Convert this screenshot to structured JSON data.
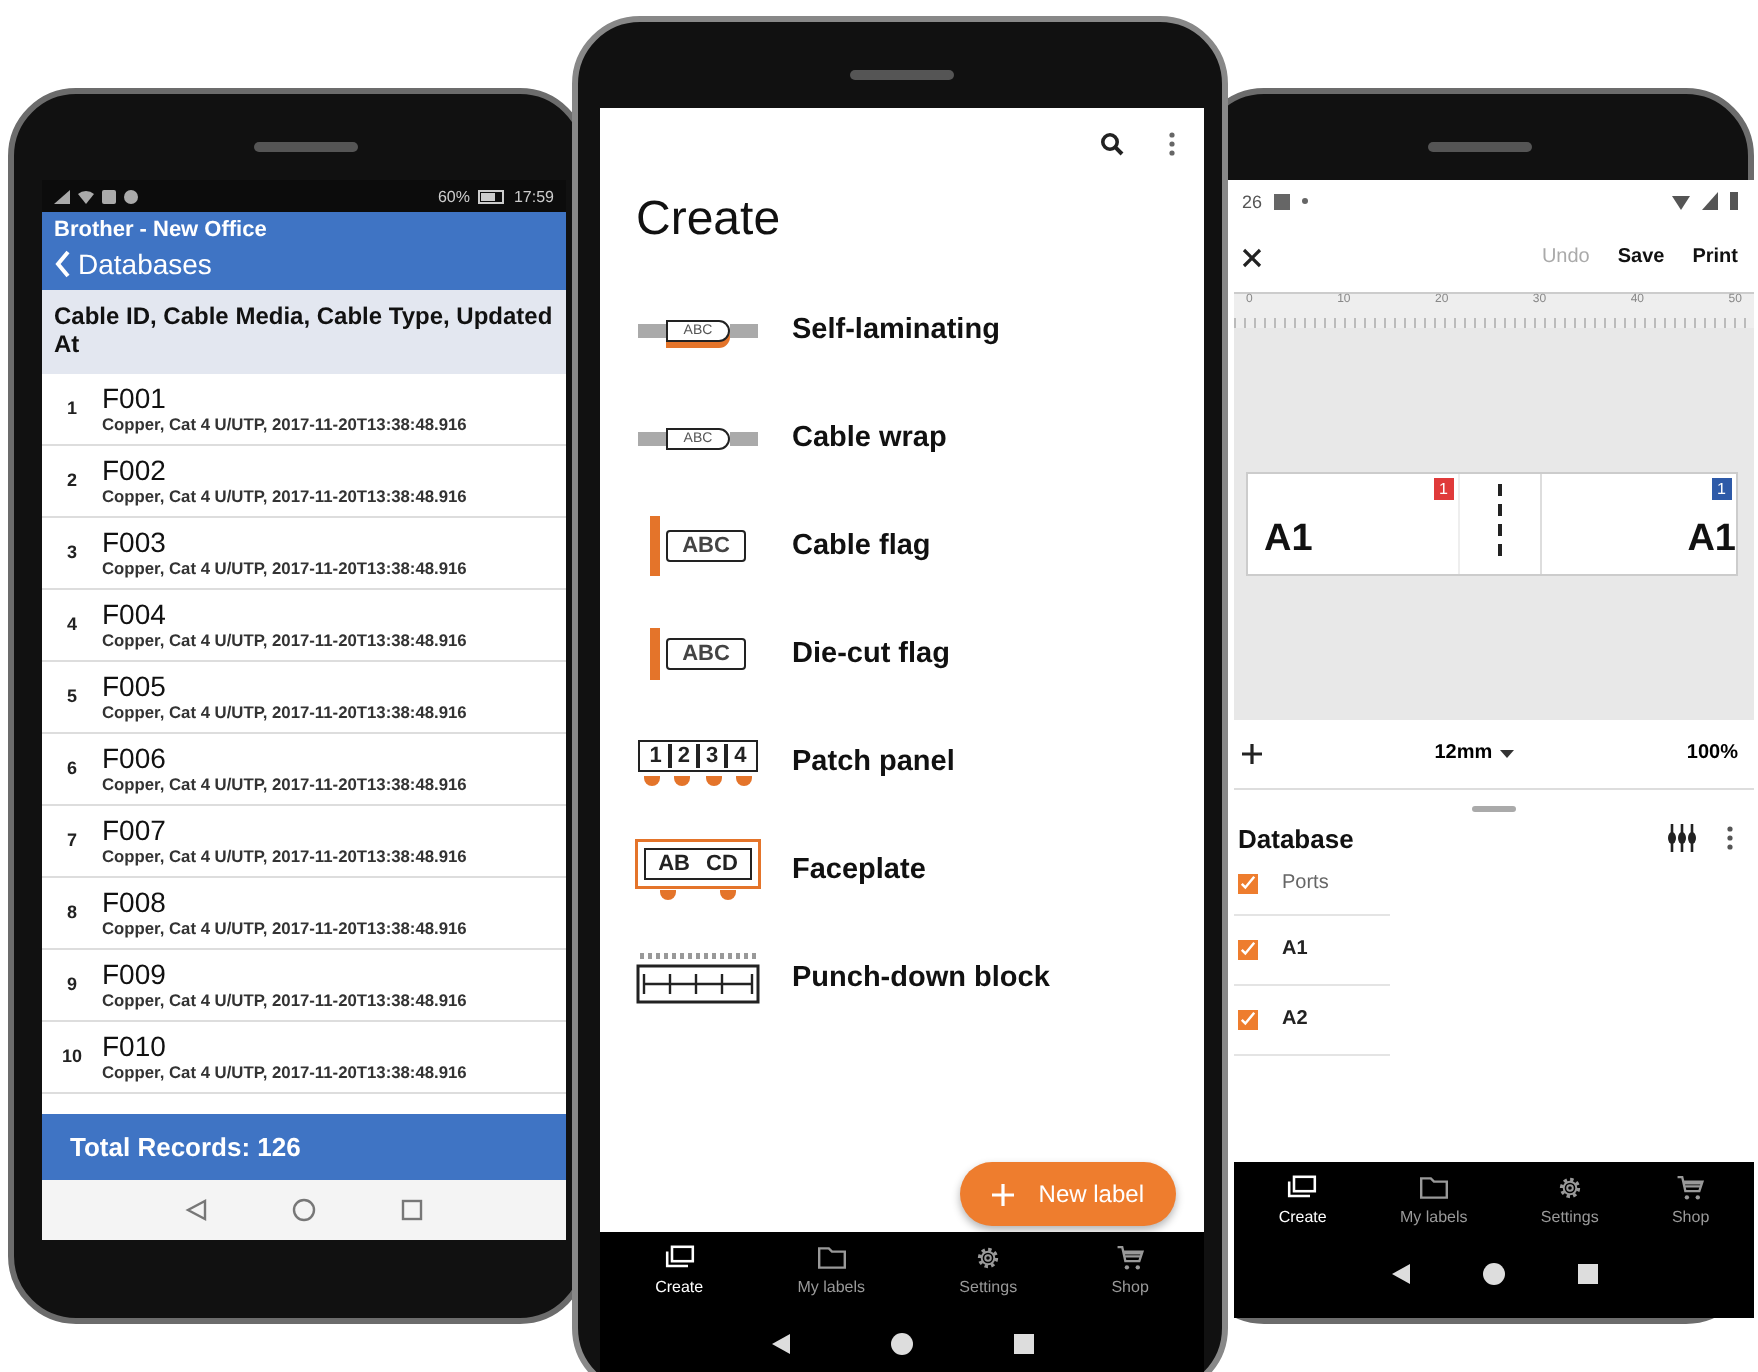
{
  "database_phone": {
    "status_bar": {
      "battery": "60%",
      "time": "17:59"
    },
    "header": {
      "title": "Brother - New Office",
      "back": "Databases"
    },
    "columns_heading": "Cable ID, Cable Media, Cable Type, Updated At",
    "rows": [
      {
        "number": "1",
        "id": "F001",
        "details": "Copper, Cat 4 U/UTP, 2017-11-20T13:38:48.916"
      },
      {
        "number": "2",
        "id": "F002",
        "details": "Copper, Cat 4 U/UTP, 2017-11-20T13:38:48.916"
      },
      {
        "number": "3",
        "id": "F003",
        "details": "Copper, Cat 4 U/UTP, 2017-11-20T13:38:48.916"
      },
      {
        "number": "4",
        "id": "F004",
        "details": "Copper, Cat 4 U/UTP, 2017-11-20T13:38:48.916"
      },
      {
        "number": "5",
        "id": "F005",
        "details": "Copper, Cat 4 U/UTP, 2017-11-20T13:38:48.916"
      },
      {
        "number": "6",
        "id": "F006",
        "details": "Copper, Cat 4 U/UTP, 2017-11-20T13:38:48.916"
      },
      {
        "number": "7",
        "id": "F007",
        "details": "Copper, Cat 4 U/UTP, 2017-11-20T13:38:48.916"
      },
      {
        "number": "8",
        "id": "F008",
        "details": "Copper, Cat 4 U/UTP, 2017-11-20T13:38:48.916"
      },
      {
        "number": "9",
        "id": "F009",
        "details": "Copper, Cat 4 U/UTP, 2017-11-20T13:38:48.916"
      },
      {
        "number": "10",
        "id": "F010",
        "details": "Copper, Cat 4 U/UTP, 2017-11-20T13:38:48.916"
      }
    ],
    "footer": "Total Records: 126"
  },
  "create_phone": {
    "title": "Create",
    "label_types": [
      {
        "kind": "laminated",
        "name": "Self-laminating",
        "icon_texts": [
          "ABC"
        ]
      },
      {
        "kind": "wrap",
        "name": "Cable wrap",
        "icon_texts": [
          "ABC"
        ]
      },
      {
        "kind": "flag",
        "name": "Cable flag",
        "icon_texts": [
          "ABC"
        ]
      },
      {
        "kind": "diecut",
        "name": "Die-cut flag",
        "icon_texts": [
          "ABC"
        ]
      },
      {
        "kind": "patch",
        "name": "Patch panel",
        "icon_texts": [
          "1",
          "2",
          "3",
          "4"
        ]
      },
      {
        "kind": "faceplate",
        "name": "Faceplate",
        "icon_texts": [
          "AB",
          "CD"
        ]
      },
      {
        "kind": "punchdown",
        "name": "Punch-down block"
      }
    ],
    "fab": "New label",
    "nav": [
      {
        "kind": "create",
        "label": "Create",
        "selected": true
      },
      {
        "kind": "folder",
        "label": "My labels",
        "selected": false
      },
      {
        "kind": "settings",
        "label": "Settings",
        "selected": false
      },
      {
        "kind": "shop",
        "label": "Shop",
        "selected": false
      }
    ]
  },
  "editor_phone": {
    "status_time": "26",
    "toolbar": {
      "undo": {
        "label": "Undo",
        "disabled": true
      },
      "save": "Save",
      "print": "Print"
    },
    "ruler": [
      "0",
      "10",
      "20",
      "30",
      "40",
      "50"
    ],
    "label_segments": [
      {
        "text": "A1",
        "badge": "1",
        "color": "#e03a3a"
      },
      {
        "text": "A1",
        "badge": "1",
        "color": "#2e5aa8"
      }
    ],
    "tape": "12mm",
    "zoom": "100%",
    "database": {
      "title": "Database",
      "rows": [
        {
          "kind": "header",
          "text": "Ports",
          "checked": true
        },
        {
          "kind": "record",
          "text": "A1",
          "checked": true
        },
        {
          "kind": "record",
          "text": "A2",
          "checked": true
        }
      ]
    },
    "nav": [
      {
        "kind": "create",
        "label": "Create",
        "selected": true
      },
      {
        "kind": "folder",
        "label": "My labels",
        "selected": false
      },
      {
        "kind": "settings",
        "label": "Settings",
        "selected": false
      },
      {
        "kind": "shop",
        "label": "Shop",
        "selected": false
      }
    ]
  }
}
